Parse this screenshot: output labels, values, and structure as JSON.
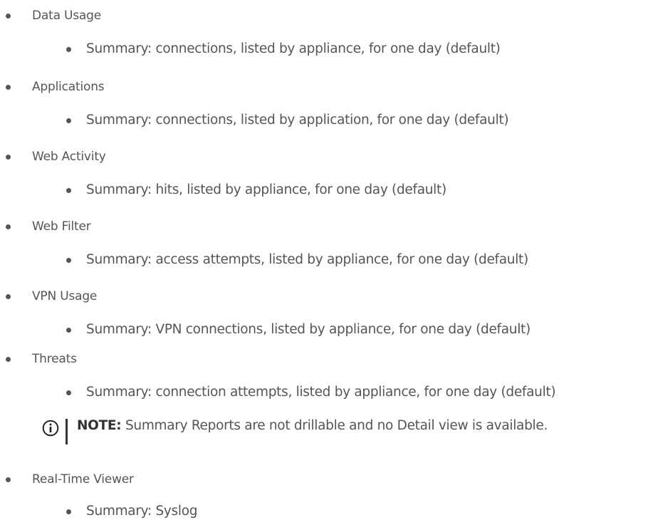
{
  "sections": [
    {
      "label": "Data Usage",
      "sub": "Summary: connections, listed by appliance, for one day (default)"
    },
    {
      "label": "Applications",
      "sub": "Summary: connections, listed by application, for one day (default)"
    },
    {
      "label": "Web Activity",
      "sub": "Summary: hits, listed by appliance, for one day (default)"
    },
    {
      "label": "Web Filter",
      "sub": "Summary: access attempts, listed by appliance, for one day (default)"
    },
    {
      "label": "VPN Usage",
      "sub": "Summary: VPN connections, listed by appliance, for one day (default)"
    },
    {
      "label": "Threats",
      "sub": "Summary: connection attempts, listed by appliance, for one day (default)"
    },
    {
      "label": "Real-Time Viewer",
      "sub": "Summary: Syslog"
    }
  ],
  "note": {
    "icon": "info-icon",
    "label": "NOTE:",
    "text": " Summary Reports are not drillable and no Detail view is available."
  }
}
